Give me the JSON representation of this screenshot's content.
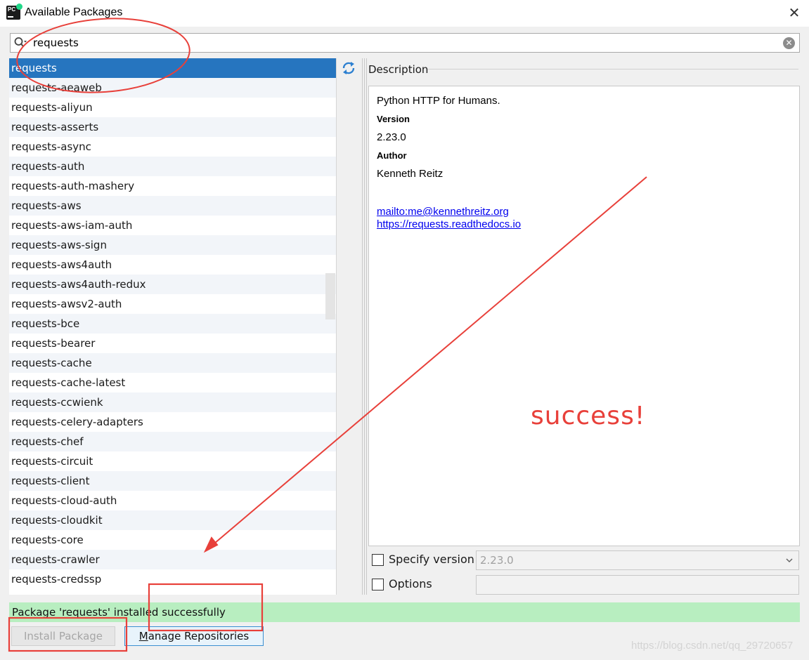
{
  "window": {
    "title": "Available Packages"
  },
  "search": {
    "value": "requests"
  },
  "packages": [
    "requests",
    "requests-aeaweb",
    "requests-aliyun",
    "requests-asserts",
    "requests-async",
    "requests-auth",
    "requests-auth-mashery",
    "requests-aws",
    "requests-aws-iam-auth",
    "requests-aws-sign",
    "requests-aws4auth",
    "requests-aws4auth-redux",
    "requests-awsv2-auth",
    "requests-bce",
    "requests-bearer",
    "requests-cache",
    "requests-cache-latest",
    "requests-ccwienk",
    "requests-celery-adapters",
    "requests-chef",
    "requests-circuit",
    "requests-client",
    "requests-cloud-auth",
    "requests-cloudkit",
    "requests-core",
    "requests-crawler",
    "requests-credssp"
  ],
  "selected_index": 0,
  "description": {
    "label": "Description",
    "summary": "Python HTTP for Humans.",
    "version_label": "Version",
    "version": "2.23.0",
    "author_label": "Author",
    "author": "Kenneth Reitz",
    "links": [
      "mailto:me@kennethreitz.org",
      "https://requests.readthedocs.io"
    ]
  },
  "options": {
    "specify_version_label": "Specify version",
    "specify_version_checked": false,
    "version_value": "2.23.0",
    "options_label": "Options",
    "options_checked": false
  },
  "status": {
    "message": "Package 'requests' installed successfully",
    "color": "#b8eec0"
  },
  "buttons": {
    "install": "Install Package",
    "manage_mnemonic": "M",
    "manage_rest": "anage Repositories"
  },
  "annotation": {
    "text": "success!",
    "color": "#e8403a"
  },
  "watermark": "https://blog.csdn.net/qq_29720657",
  "colors": {
    "selection": "#2675bf",
    "accent_border": "#3b8fd1"
  }
}
